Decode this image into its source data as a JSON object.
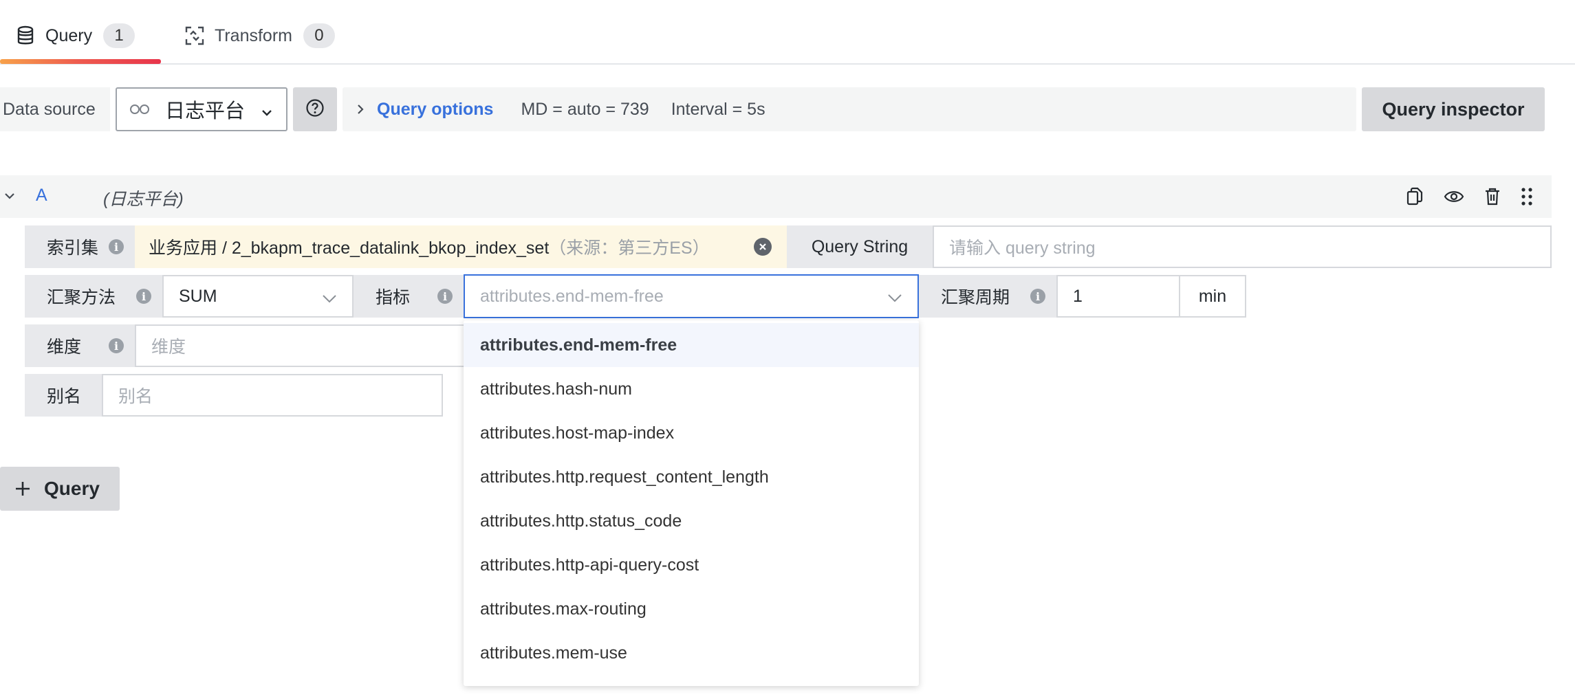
{
  "tabs": [
    {
      "label": "Query",
      "count": "1",
      "icon": "database-icon"
    },
    {
      "label": "Transform",
      "count": "0",
      "icon": "transform-icon"
    }
  ],
  "datasource": {
    "label": "Data source",
    "selected": "日志平台",
    "logo": "datasource-logo-icon"
  },
  "query_options": {
    "link_label": "Query options",
    "md": "MD = auto = 739",
    "interval": "Interval = 5s"
  },
  "inspector_label": "Query inspector",
  "query": {
    "ref_id": "A",
    "datasource_name": "(日志平台)",
    "actions": [
      "duplicate-icon",
      "eye-icon",
      "trash-icon",
      "drag-handle-icon"
    ]
  },
  "form": {
    "index_set": {
      "label": "索引集",
      "value": "业务应用 / 2_bkapm_trace_datalink_bkop_index_set",
      "source": "（来源：第三方ES）"
    },
    "query_string": {
      "label": "Query String",
      "placeholder": "请输入 query string"
    },
    "agg_method": {
      "label": "汇聚方法",
      "value": "SUM"
    },
    "metric": {
      "label": "指标",
      "placeholder": "attributes.end-mem-free"
    },
    "agg_period": {
      "label": "汇聚周期",
      "value": "1",
      "unit": "min"
    },
    "dimension": {
      "label": "维度",
      "placeholder": "维度"
    },
    "alias": {
      "label": "别名",
      "placeholder": "别名"
    }
  },
  "metric_options": [
    "attributes.end-mem-free",
    "attributes.hash-num",
    "attributes.host-map-index",
    "attributes.http.request_content_length",
    "attributes.http.status_code",
    "attributes.http-api-query-cost",
    "attributes.max-routing",
    "attributes.mem-use"
  ],
  "add_query_label": "Query",
  "colors": {
    "accent_blue": "#3871dc",
    "tab_gradient_start": "#f7a14a",
    "tab_gradient_end": "#e8354b",
    "index_bg": "#fdf7e4",
    "selected_border": "#3871dc"
  }
}
